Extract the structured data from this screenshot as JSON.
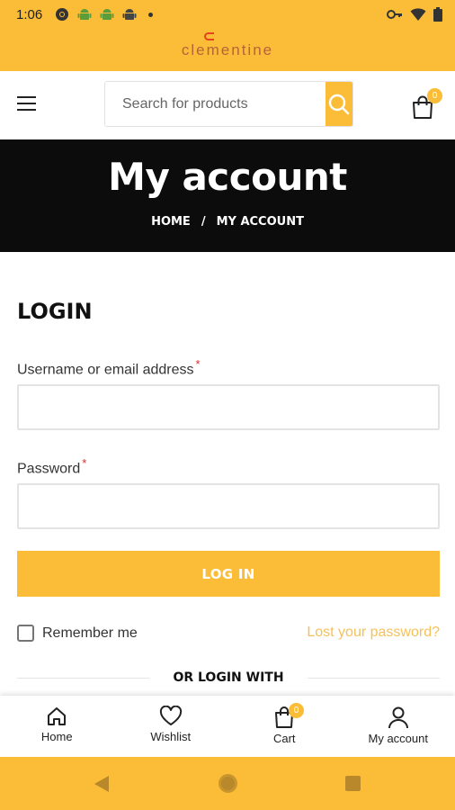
{
  "status_bar": {
    "time": "1:06",
    "left_icons": [
      "chrome-icon",
      "android-icon",
      "android-icon",
      "android-icon"
    ],
    "right_icons": [
      "key-icon",
      "wifi-icon",
      "battery-icon"
    ]
  },
  "brand": {
    "logo_text": "clementine"
  },
  "header": {
    "search_placeholder": "Search for products",
    "cart_count": "0"
  },
  "hero": {
    "title": "My account",
    "breadcrumb": {
      "home": "HOME",
      "separator": "/",
      "current": "MY ACCOUNT"
    }
  },
  "login": {
    "title": "LOGIN",
    "username_label": "Username or email address",
    "username_value": "",
    "password_label": "Password",
    "password_value": "",
    "required_mark": "*",
    "submit_label": "LOG IN",
    "remember_label": "Remember me",
    "remember_checked": false,
    "lost_password": "Lost your password?",
    "or_login_with": "OR LOGIN WITH"
  },
  "bottom_nav": {
    "items": [
      {
        "label": "Home",
        "icon": "home-icon"
      },
      {
        "label": "Wishlist",
        "icon": "heart-icon"
      },
      {
        "label": "Cart",
        "icon": "cart-icon",
        "badge": "0"
      },
      {
        "label": "My account",
        "icon": "user-icon"
      }
    ]
  },
  "colors": {
    "accent": "#fbbd38",
    "hero_bg": "#0c0c0c",
    "required": "#e02b2b",
    "link": "#f5c15a"
  }
}
